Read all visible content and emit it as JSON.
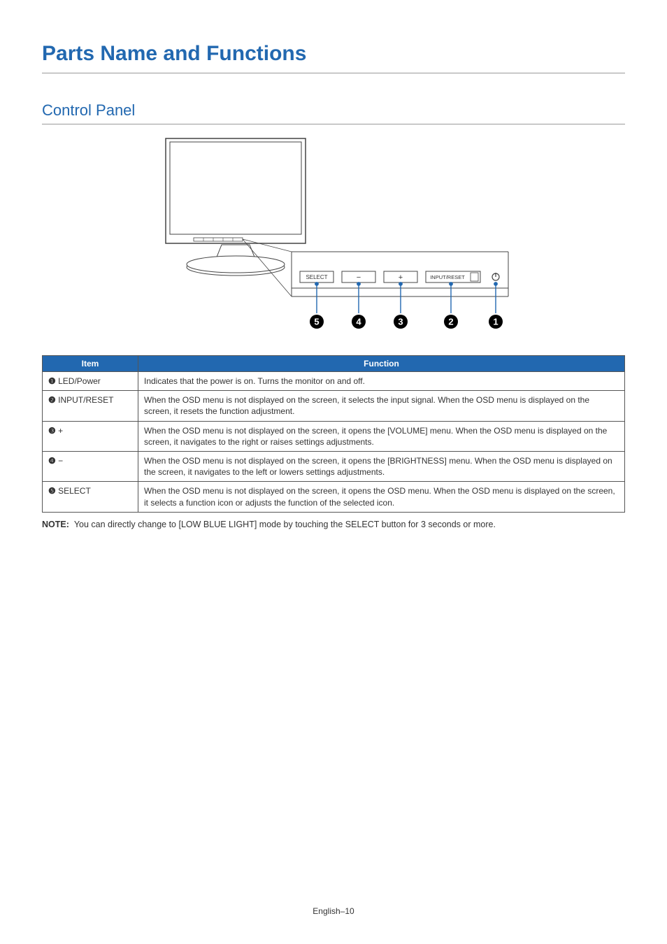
{
  "page_title": "Parts Name and Functions",
  "section_title": "Control Panel",
  "diagram": {
    "panel_labels": {
      "select": "SELECT",
      "minus": "−",
      "plus": "+",
      "input_reset": "INPUT/RESET"
    },
    "callouts": [
      "5",
      "4",
      "3",
      "2",
      "1"
    ]
  },
  "table": {
    "headers": {
      "item": "Item",
      "function": "Function"
    },
    "rows": [
      {
        "num": "1",
        "label": "LED/Power",
        "function": "Indicates that the power is on. Turns the monitor on and off."
      },
      {
        "num": "2",
        "label": "INPUT/RESET",
        "function": "When the OSD menu is not displayed on the screen, it selects the input signal. When the OSD menu is displayed on the screen, it resets the function adjustment."
      },
      {
        "num": "3",
        "label": "+",
        "function": "When the OSD menu is not displayed on the screen, it opens the [VOLUME] menu. When the OSD menu is displayed on the screen, it navigates to the right or raises settings adjustments."
      },
      {
        "num": "4",
        "label": "−",
        "function": "When the OSD menu is not displayed on the screen, it opens the [BRIGHTNESS] menu. When the OSD menu is displayed on the screen, it navigates to the left or lowers settings adjustments."
      },
      {
        "num": "5",
        "label": "SELECT",
        "function": "When the OSD menu is not displayed on the screen, it opens the OSD menu. When the OSD menu is displayed on the screen, it selects a function icon or adjusts the function of the selected icon."
      }
    ]
  },
  "note": {
    "label": "NOTE:",
    "text": "You can directly change to [LOW BLUE LIGHT] mode by touching the SELECT button for 3 seconds or more."
  },
  "footer": "English–10"
}
